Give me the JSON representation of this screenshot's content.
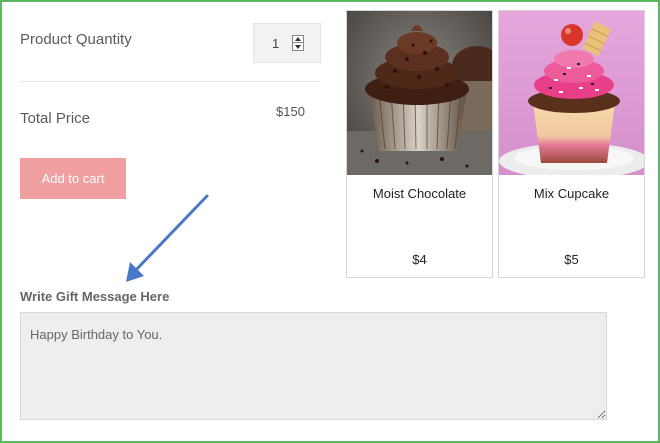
{
  "product": {
    "quantity_label": "Product Quantity",
    "quantity_value": "1",
    "total_label": "Total Price",
    "total_value": "$150",
    "add_to_cart_label": "Add to cart"
  },
  "cards": [
    {
      "name": "Moist Chocolate",
      "price": "$4",
      "image": "chocolate-cupcake"
    },
    {
      "name": "Mix Cupcake",
      "price": "$5",
      "image": "mix-cupcake"
    }
  ],
  "gift": {
    "label": "Write Gift Message Here",
    "message": "Happy Birthday to You."
  },
  "colors": {
    "frame": "#5cb85c",
    "button": "#ef9f9f",
    "arrow": "#4a78c8"
  },
  "icons": [
    "spinner-up-icon",
    "spinner-down-icon",
    "annotation-arrow"
  ]
}
